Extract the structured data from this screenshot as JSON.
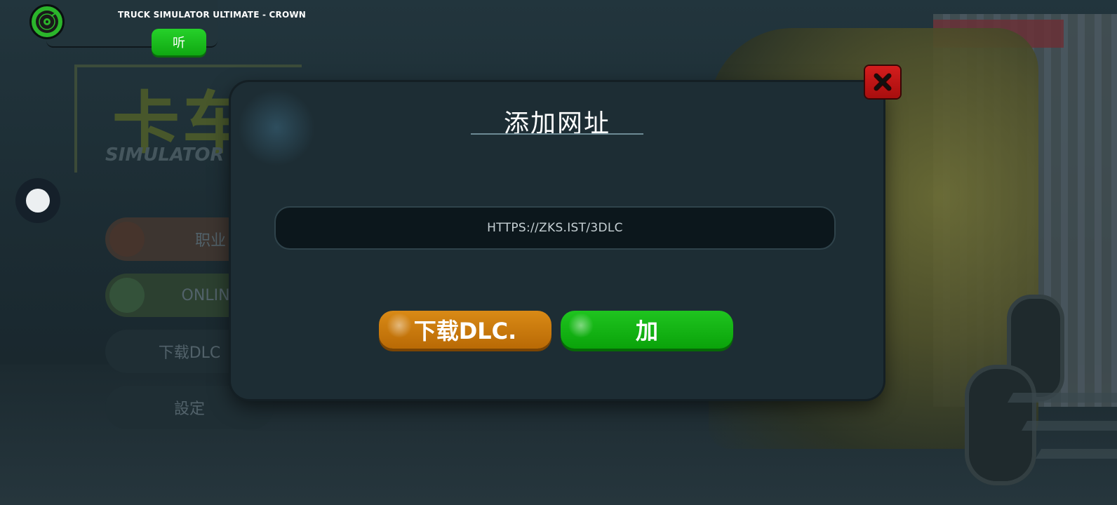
{
  "music_widget": {
    "track_title": "TRUCK SIMULATOR ULTIMATE - CROWN",
    "listen_label": "听",
    "icon": "music-disc-icon"
  },
  "background_menu": {
    "logo_glyph": "卡车",
    "logo_sub": "SIMULATOR ULT",
    "items": [
      {
        "label": "职业"
      },
      {
        "label": "ONLINE",
        "sub": ""
      },
      {
        "label": "下载DLC"
      },
      {
        "label": "設定"
      }
    ]
  },
  "dialog": {
    "title": "添加网址",
    "url_value": "HTTPS://ZKS.IST/3DLC",
    "download_button": "下载DLC.",
    "add_button": "加",
    "close_icon": "close-x-icon"
  },
  "colors": {
    "dialog_bg": "#1d2d34",
    "download_orange": "#c97a0c",
    "add_green": "#10b010",
    "close_red": "#c41515",
    "listen_green": "#18bd1b"
  }
}
